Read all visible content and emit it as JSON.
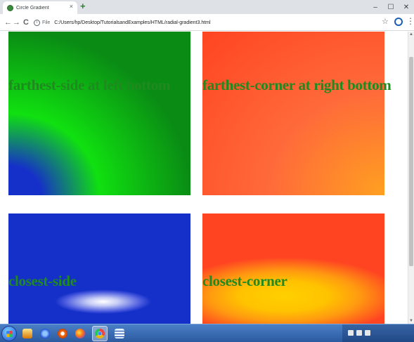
{
  "browser": {
    "tab": {
      "title": "Circle Gradient",
      "close_label": "×"
    },
    "new_tab_label": "+",
    "window_buttons": {
      "minimize": "–",
      "maximize": "☐",
      "close": "✕"
    },
    "nav": {
      "back": "←",
      "forward": "→",
      "reload": "C"
    },
    "address": {
      "prefix": "File",
      "url": "C:/Users/hp/Desktop/TutorialsandExamples/HTML/radial-gradient3.html"
    }
  },
  "page": {
    "boxes": [
      {
        "label": "farthest-side at left bottom",
        "gradient": "farthest-side at left bottom"
      },
      {
        "label": "farthest-corner at right bottom",
        "gradient": "farthest-corner at right bottom"
      },
      {
        "label": "closest-side",
        "gradient": "closest-side"
      },
      {
        "label": "closest-corner",
        "gradient": "closest-corner"
      }
    ],
    "heading_color": "#1f8a1f"
  },
  "taskbar": {
    "items": [
      {
        "icon": "start-orb-icon"
      },
      {
        "icon": "file-explorer-icon"
      },
      {
        "icon": "internet-explorer-icon"
      },
      {
        "icon": "media-player-icon"
      },
      {
        "icon": "firefox-icon"
      },
      {
        "icon": "chrome-icon",
        "active": true
      },
      {
        "icon": "text-editor-icon"
      }
    ]
  },
  "colors": {
    "green_box": "#10e010",
    "blue_box": "#1530c8",
    "red_orange_box": "#ff4422",
    "yellow_center": "#ffd000"
  }
}
